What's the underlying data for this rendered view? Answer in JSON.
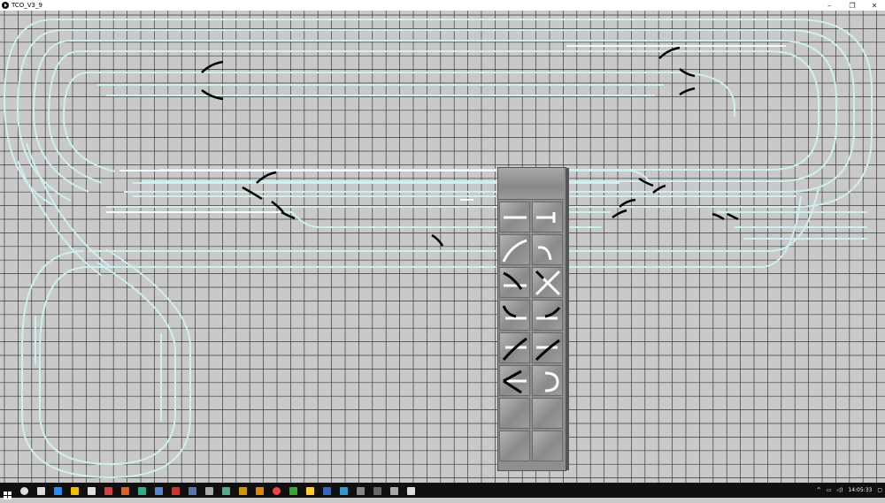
{
  "window": {
    "title": "TCO_V3_9",
    "minimize_glyph": "–",
    "restore_glyph": "❐",
    "close_glyph": "✕"
  },
  "colors": {
    "grid_bg": "#c9c9c9",
    "grid_line": "#3a3a3a",
    "track": "#cfeeee",
    "turnout": "#000000",
    "palette_tile": "#9a9a9a",
    "taskbar": "#101010"
  },
  "palette": {
    "tiles": [
      {
        "icon": "straight-track-icon"
      },
      {
        "icon": "track-end-icon"
      },
      {
        "icon": "curve-track-icon"
      },
      {
        "icon": "small-curve-icon"
      },
      {
        "icon": "turnout-left-icon"
      },
      {
        "icon": "crossing-icon"
      },
      {
        "icon": "turnout-curve-left-icon"
      },
      {
        "icon": "turnout-curve-right-icon"
      },
      {
        "icon": "double-slip-left-icon"
      },
      {
        "icon": "double-slip-right-icon"
      },
      {
        "icon": "three-way-turnout-icon"
      },
      {
        "icon": "u-turn-icon"
      },
      {
        "icon": "empty-tile"
      },
      {
        "icon": "empty-tile"
      },
      {
        "icon": "empty-tile"
      },
      {
        "icon": "empty-tile"
      }
    ]
  },
  "taskbar": {
    "icons": [
      "search-icon",
      "task-view-icon",
      "edge-icon",
      "file-explorer-icon",
      "store-icon",
      "app-icon",
      "app-icon",
      "app-icon",
      "app-icon",
      "app-icon",
      "app-icon",
      "app-icon",
      "app-icon",
      "app-icon",
      "app-icon",
      "chrome-icon",
      "app-icon",
      "app-icon",
      "app-icon",
      "app-icon",
      "app-icon",
      "app-icon",
      "app-icon",
      "app-icon"
    ],
    "tray_chevron": "^",
    "clock": "14:05:33"
  }
}
